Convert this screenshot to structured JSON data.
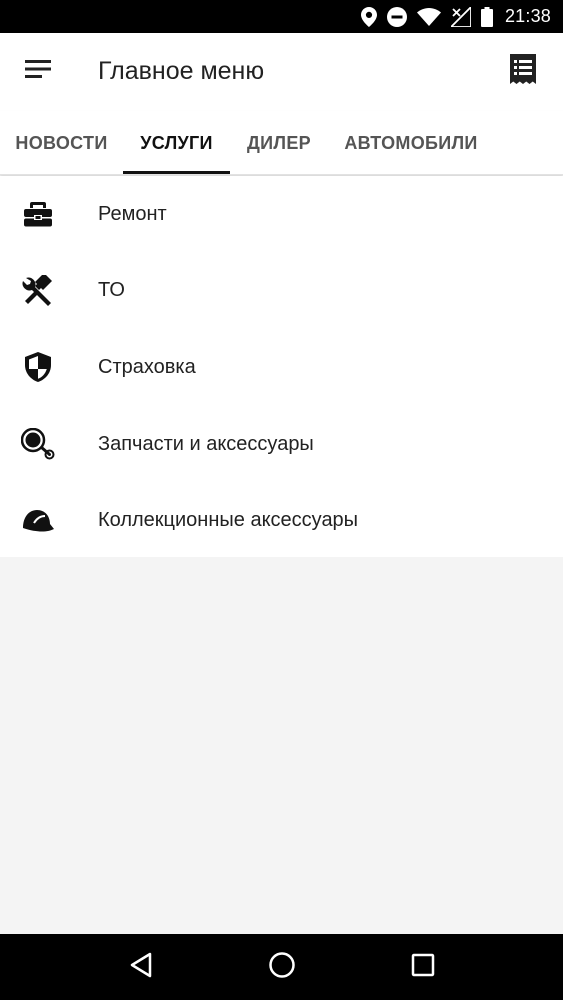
{
  "status_bar": {
    "time": "21:38",
    "icons": [
      "location-icon",
      "do-not-disturb-icon",
      "wifi-icon",
      "no-signal-icon",
      "battery-icon"
    ]
  },
  "app_bar": {
    "title": "Главное меню",
    "menu_icon": "hamburger-menu-icon",
    "action_icon": "receipt-icon"
  },
  "tabs": [
    {
      "label": "НОВОСТИ",
      "active": false
    },
    {
      "label": "УСЛУГИ",
      "active": true
    },
    {
      "label": "ДИЛЕР",
      "active": false
    },
    {
      "label": "АВТОМОБИЛИ",
      "active": false
    }
  ],
  "services": [
    {
      "label": "Ремонт",
      "icon": "toolbox-icon"
    },
    {
      "label": "ТО",
      "icon": "wrench-screwdriver-icon"
    },
    {
      "label": "Страховка",
      "icon": "shield-icon"
    },
    {
      "label": "Запчасти и аксессуары",
      "icon": "belt-pulley-icon"
    },
    {
      "label": "Коллекционные аксессуары",
      "icon": "cap-icon"
    }
  ],
  "nav_bar": {
    "icons": [
      "back-icon",
      "home-icon",
      "recents-icon"
    ]
  },
  "colors": {
    "status_bar": "#000000",
    "surface": "#ffffff",
    "background": "#f4f4f4",
    "text_primary": "#222222",
    "tab_inactive": "#555555",
    "tab_indicator": "#111111"
  }
}
